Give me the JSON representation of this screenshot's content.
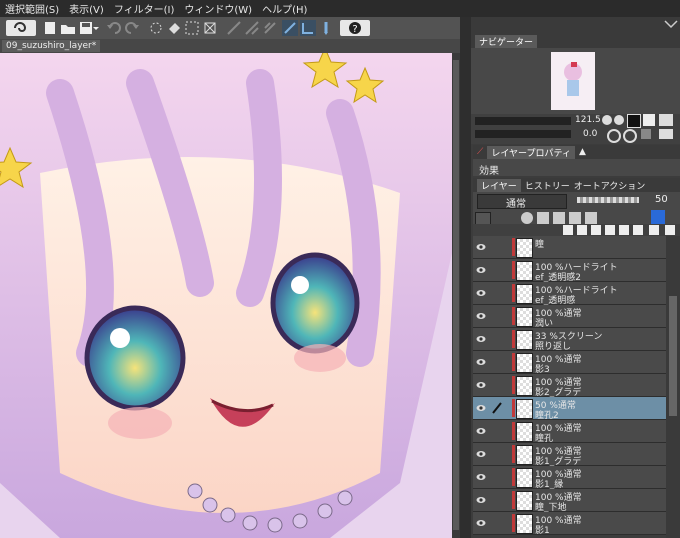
{
  "menu": [
    "選択範囲(S)",
    "表示(V)",
    "フィルター(I)",
    "ウィンドウ(W)",
    "ヘルプ(H)"
  ],
  "document": {
    "tab_title": "09_suzushiro_layer*"
  },
  "navigator": {
    "tab_label": "ナビゲーター",
    "zoom": "121.5",
    "rotation": "0.0"
  },
  "properties": {
    "tab_label": "レイヤープロパティ",
    "effect_label": "効果"
  },
  "layer_panel": {
    "tabs": [
      "レイヤー",
      "ヒストリー",
      "オートアクション"
    ],
    "blend_mode": "通常",
    "opacity": "50",
    "layers": [
      {
        "line1": "瞳",
        "line2": "",
        "selected": false
      },
      {
        "line1": "100 %ハードライト",
        "line2": "ef_透明感2",
        "selected": false
      },
      {
        "line1": "100 %ハードライト",
        "line2": "ef_透明感",
        "selected": false
      },
      {
        "line1": "100 %通常",
        "line2": "潤い",
        "selected": false
      },
      {
        "line1": "33 %スクリーン",
        "line2": "照り返し",
        "selected": false
      },
      {
        "line1": "100 %通常",
        "line2": "影3",
        "selected": false
      },
      {
        "line1": "100 %通常",
        "line2": "影2_グラデ",
        "selected": false
      },
      {
        "line1": "50 %通常",
        "line2": "瞳孔2",
        "selected": true
      },
      {
        "line1": "100 %通常",
        "line2": "瞳孔",
        "selected": false
      },
      {
        "line1": "100 %通常",
        "line2": "影1_グラデ",
        "selected": false
      },
      {
        "line1": "100 %通常",
        "line2": "影1_縁",
        "selected": false
      },
      {
        "line1": "100 %通常",
        "line2": "瞳_下地",
        "selected": false
      },
      {
        "line1": "100 %通常",
        "line2": "影1",
        "selected": false
      }
    ]
  },
  "colors": {
    "accent": "#6d8fa6",
    "layer_mark": "#c03a3a"
  }
}
